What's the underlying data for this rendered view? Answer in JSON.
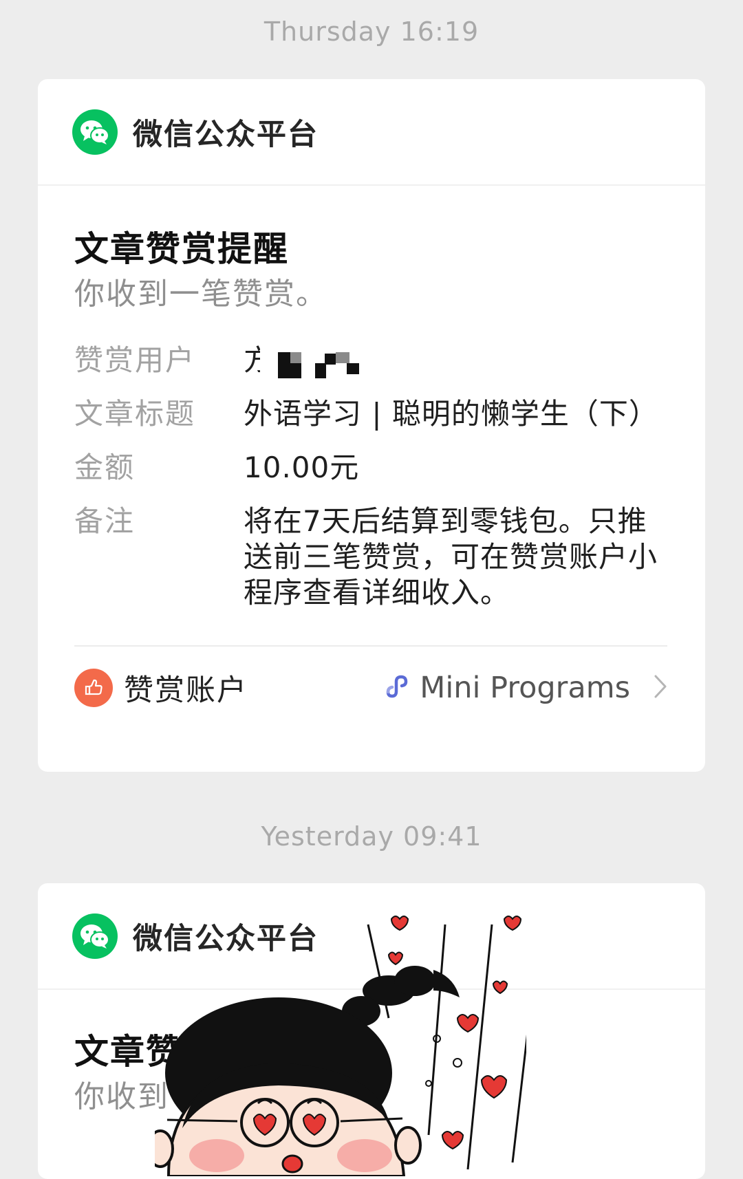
{
  "messages": [
    {
      "timestamp": "Thursday 16:19",
      "account": "微信公众平台",
      "title": "文章赞赏提醒",
      "subtitle": "你收到一笔赞赏。",
      "fields": {
        "user_label": "赞赏用户",
        "user_value_prefix": "方",
        "article_label": "文章标题",
        "article_value": "外语学习 | 聪明的懒学生（下）",
        "amount_label": "金额",
        "amount_value": "10.00元",
        "note_label": "备注",
        "note_value": "将在7天后结算到零钱包。只推送前三笔赞赏，可在赞赏账户小程序查看详细收入。"
      },
      "footer": {
        "account_label": "赞赏账户",
        "mini_programs_label": "Mini Programs"
      }
    },
    {
      "timestamp": "Yesterday 09:41",
      "account": "微信公众平台",
      "title": "文章赞赏提醒",
      "subtitle": "你收到一笔赞赏。"
    }
  ],
  "icons": {
    "account_icon": "wechat-icon",
    "reward_icon": "thumbs-up-icon",
    "mini_program_icon": "mini-program-link-icon",
    "chevron": "chevron-right-icon"
  },
  "colors": {
    "wechat_green": "#07c160",
    "reward_orange": "#f36a4a",
    "mini_program_blue": "#5b6bd6"
  }
}
